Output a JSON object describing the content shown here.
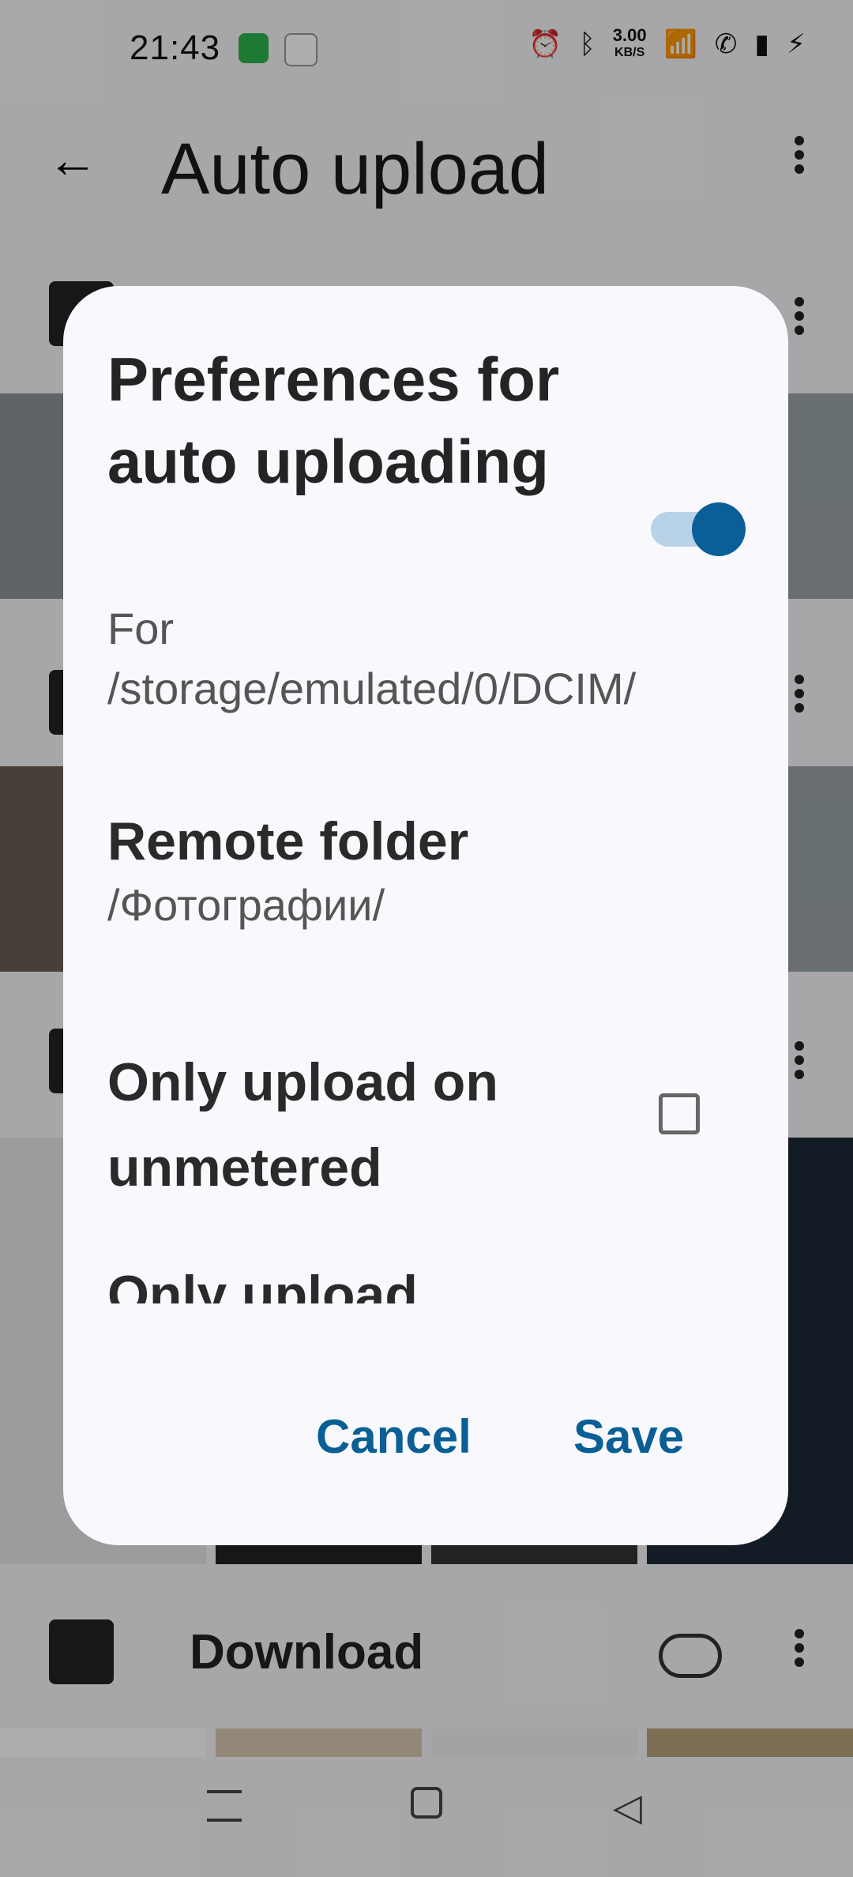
{
  "status_bar": {
    "time": "21:43",
    "network_speed": "3.00",
    "network_unit": "KB/S",
    "icons": [
      "messages-icon",
      "mail-icon",
      "alarm-icon",
      "bluetooth-icon",
      "wifi-icon",
      "vowifi-icon",
      "signal-icon",
      "charging-icon"
    ]
  },
  "header": {
    "title": "Auto upload"
  },
  "folders": [
    {
      "name": ""
    },
    {
      "name": ""
    },
    {
      "name": ""
    },
    {
      "name": "Download"
    }
  ],
  "dialog": {
    "title": "Preferences for auto uploading",
    "subtitle": "For /storage/emulated/0/DCIM/",
    "toggle_enabled": true,
    "remote_folder_label": "Remote folder",
    "remote_folder_value": "/Фотографии/",
    "unmetered_label": "Only upload on unmetered",
    "unmetered_checked": false,
    "next_item_label": "Only upload",
    "cancel_label": "Cancel",
    "save_label": "Save"
  },
  "colors": {
    "accent": "#0b5f98",
    "toggle_track": "#b8d3e7"
  }
}
